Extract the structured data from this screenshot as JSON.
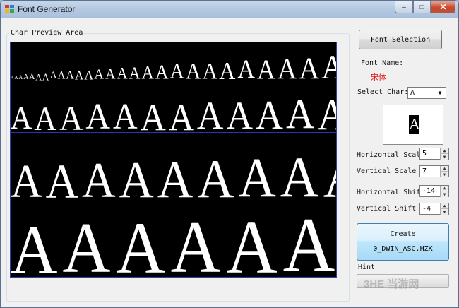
{
  "window": {
    "title": "Font Generator",
    "controls": {
      "minimize": "–",
      "maximize": "□",
      "close": "✕"
    }
  },
  "preview": {
    "label": "Char Preview Area",
    "glyph": "A",
    "rows": [
      {
        "name": "row-1",
        "sizes": [
          6,
          7,
          8,
          10,
          11,
          12,
          13,
          14,
          15,
          16,
          17,
          18,
          19,
          20,
          21,
          22,
          24,
          26,
          28,
          30,
          30,
          32,
          34,
          36,
          38,
          40,
          44,
          46
        ]
      },
      {
        "name": "row-2",
        "sizes": [
          42,
          44,
          46,
          48,
          48,
          50,
          50,
          52,
          52,
          54,
          56,
          58,
          60,
          62
        ]
      },
      {
        "name": "row-3",
        "sizes": [
          62,
          64,
          66,
          68,
          70,
          72,
          74,
          76,
          78,
          80
        ]
      },
      {
        "name": "row-4",
        "sizes": [
          92,
          94,
          96,
          98,
          100,
          102,
          104,
          106,
          108
        ]
      }
    ]
  },
  "controls": {
    "font_selection_label": "Font Selection",
    "font_name_label": "Font Name:",
    "font_name_value": "宋体",
    "select_char_label": "Select Char:",
    "select_char_value": "A",
    "char_preview_glyph": "A",
    "horizontal_scale_label": "Horizontal Scale",
    "horizontal_scale_value": "5",
    "vertical_scale_label": "Vertical Scale",
    "vertical_scale_value": "7",
    "horizontal_shift_label": "Horizontal Shift",
    "horizontal_shift_value": "-14",
    "vertical_shift_label": "Vertical Shift",
    "vertical_shift_value": "-4",
    "create_label": "Create",
    "create_filename": "0_DWIN_ASC.HZK",
    "hint_label": "Hint"
  },
  "watermark": "3HE 当游网",
  "colors": {
    "font_name_value": "#e01010",
    "preview_background": "#000000",
    "row_divider": "#2a33a8"
  }
}
